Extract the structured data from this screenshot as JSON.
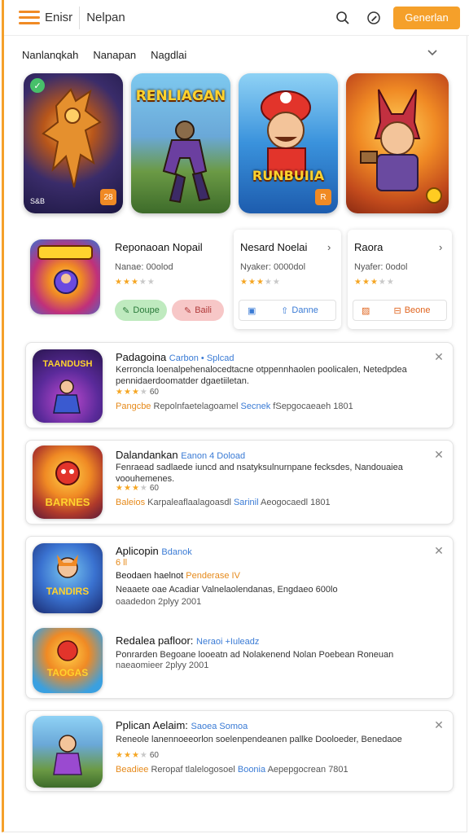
{
  "header": {
    "brand": "Enisr",
    "search_text": "Nelpan",
    "get_button": "Generlan",
    "accent": "#f5a02a"
  },
  "tabs": [
    "Nanlanqkah",
    "Nanapan",
    "Nagdlai"
  ],
  "featured": [
    {
      "title": "",
      "small": "S&B",
      "corner": "28"
    },
    {
      "title": "RENLIAGAN",
      "small": "",
      "corner": ""
    },
    {
      "title": "RUNBUIIA",
      "small": "",
      "corner": "R"
    },
    {
      "title": "",
      "small": "",
      "corner": ""
    }
  ],
  "section2": {
    "item1": {
      "title": "Reponaoan Nopail",
      "meta": "Nanae: 00olod",
      "btn_green": "Doupe",
      "btn_pink": "Baili"
    },
    "item2": {
      "title": "Nesard Noelai",
      "meta": "Nyaker: 0000dol",
      "btn_label": "Danne"
    },
    "item3": {
      "title": "Raora",
      "meta": "Nyafer: 0odol",
      "btn_label": "Beone"
    }
  },
  "list": [
    {
      "title": "Padagoina",
      "tag": "Carbon • Splcad",
      "desc": "Kerroncla loenalpehenalocedtacne otppennhaolen poolicalen, Netedpdea pennidaerdoomatder dgaetiiletan.",
      "rating": "60",
      "foot_o": "Pangcbe",
      "foot_g": "Repolnfaetelagoamel",
      "foot_b": "Secnek",
      "foot_g2": "fSepgocaeaeh 1801",
      "icon_text": "TAANDUSH"
    },
    {
      "title": "Dalandankan",
      "tag": "Eanon 4 Doload",
      "desc": "Fenraead sadlaede iuncd and nsatyksulnurnpane fecksdes, Nandouaiea voouhemenes.",
      "rating": "60",
      "foot_o": "Baleios",
      "foot_g": "Karpaleaflaalagoasdl",
      "foot_b": "Sarinil",
      "foot_g2": "Aeogocaedl 1801",
      "icon_text": "BARNES"
    }
  ],
  "group": {
    "a": {
      "title": "Aplicopin",
      "tag": "Bdanok",
      "sub_orange": "6 ll",
      "line1": "Beodaen haelnot",
      "line1_tag": "Penderase IV",
      "desc": "Neaaete oae Acadiar Valnelaolendanas, Engdaeo 600lo",
      "date": "oaadedon 2plyy 2001",
      "icon_text": "TANDIRS"
    },
    "b": {
      "title": "Redalea pafloor:",
      "tag": "Neraoi +Iuleadz",
      "desc": "Ponrarden Begoane looeatn ad Nolakenend Nolan Poebean Roneuan",
      "date": "naeaomieer 2plyy 2001",
      "icon_text": "TAOGAS"
    }
  },
  "last": {
    "title": "Pplican Aelaim:",
    "tag": "Saoea Somoa",
    "desc": "Reneole lanennoeeorlon soelenpendeanen pallke Dooloeder, Benedaoe",
    "rating": "60",
    "foot_o": "Beadiee",
    "foot_g": "Reropaf tlalelogosoel",
    "foot_b": "Boonia",
    "foot_g2": "Aepepgocrean 7801"
  }
}
